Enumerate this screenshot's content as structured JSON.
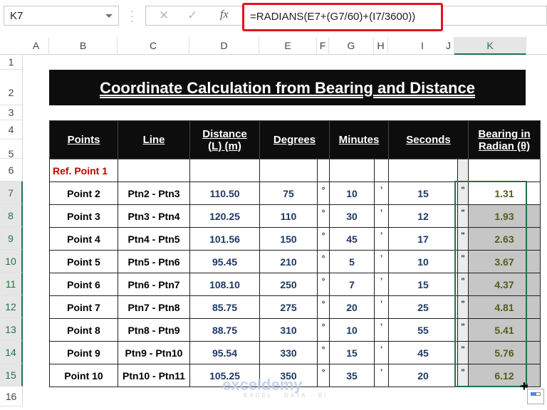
{
  "formula_bar": {
    "name_box": "K7",
    "cancel_icon": "✕",
    "enter_icon": "✓",
    "fx_label": "fx",
    "formula": "=RADIANS(E7+(G7/60)+(I7/3600))"
  },
  "columns": [
    "A",
    "B",
    "C",
    "D",
    "E",
    "F",
    "G",
    "H",
    "I",
    "J",
    "K"
  ],
  "selected_column": "K",
  "rows": [
    "1",
    "2",
    "3",
    "4",
    "5",
    "6",
    "7",
    "8",
    "9",
    "10",
    "11",
    "12",
    "13",
    "14",
    "15",
    "16"
  ],
  "title": "Coordinate Calculation from Bearing and Distance",
  "headers": {
    "points": "Points",
    "line": "Line",
    "distance": "Distance (L) (m)",
    "distance_l1": "Distance",
    "distance_l2": "(L) (m)",
    "degrees": "Degrees",
    "minutes": "Minutes",
    "seconds": "Seconds",
    "bearing_l1": "Bearing in",
    "bearing_l2": "Radian (θ)"
  },
  "ref_point": "Ref. Point 1",
  "symbols": {
    "degree": "°",
    "minute": "’",
    "second": "\""
  },
  "data_rows": [
    {
      "point": "Point 2",
      "line": "Ptn2 - Ptn3",
      "distance": "110.50",
      "deg": "75",
      "min": "10",
      "sec": "15",
      "rad": "1.31"
    },
    {
      "point": "Point 3",
      "line": "Ptn3 - Ptn4",
      "distance": "120.25",
      "deg": "110",
      "min": "30",
      "sec": "12",
      "rad": "1.93"
    },
    {
      "point": "Point 4",
      "line": "Ptn4 - Ptn5",
      "distance": "101.56",
      "deg": "150",
      "min": "45",
      "sec": "17",
      "rad": "2.63"
    },
    {
      "point": "Point 5",
      "line": "Ptn5 - Ptn6",
      "distance": "95.45",
      "deg": "210",
      "min": "5",
      "sec": "10",
      "rad": "3.67"
    },
    {
      "point": "Point 6",
      "line": "Ptn6 - Ptn7",
      "distance": "108.10",
      "deg": "250",
      "min": "7",
      "sec": "15",
      "rad": "4.37"
    },
    {
      "point": "Point 7",
      "line": "Ptn7 - Ptn8",
      "distance": "85.75",
      "deg": "275",
      "min": "20",
      "sec": "25",
      "rad": "4.81"
    },
    {
      "point": "Point 8",
      "line": "Ptn8 - Ptn9",
      "distance": "88.75",
      "deg": "310",
      "min": "10",
      "sec": "55",
      "rad": "5.41"
    },
    {
      "point": "Point 9",
      "line": "Ptn9 - Ptn10",
      "distance": "95.54",
      "deg": "330",
      "min": "15",
      "sec": "45",
      "rad": "5.76"
    },
    {
      "point": "Point 10",
      "line": "Ptn10 - Ptn11",
      "distance": "105.25",
      "deg": "350",
      "min": "35",
      "sec": "20",
      "rad": "6.12"
    }
  ],
  "watermark": {
    "brand": "exceldemy",
    "tagline": "EXCEL · DATA · BI"
  },
  "colors": {
    "selection": "#217346",
    "highlight_border": "#e8101a",
    "ref_text": "#c00000",
    "value_text": "#1f3864"
  }
}
